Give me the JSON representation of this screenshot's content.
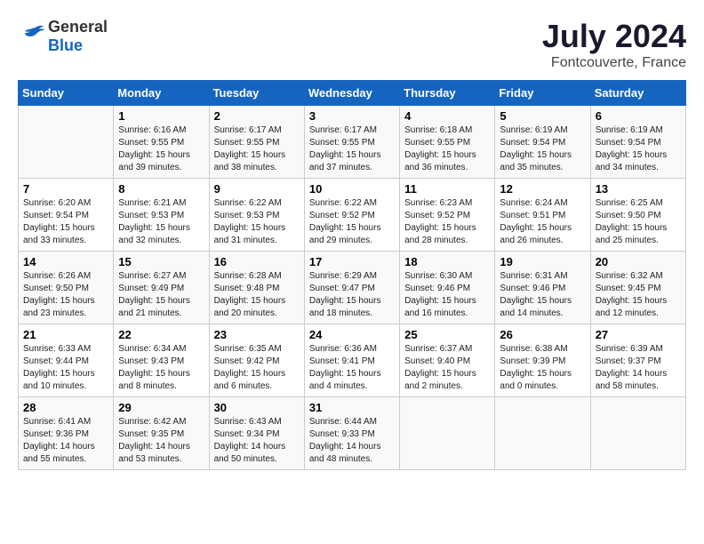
{
  "header": {
    "logo": {
      "general": "General",
      "blue": "Blue"
    },
    "title": "July 2024",
    "location": "Fontcouverte, France"
  },
  "weekdays": [
    "Sunday",
    "Monday",
    "Tuesday",
    "Wednesday",
    "Thursday",
    "Friday",
    "Saturday"
  ],
  "weeks": [
    [
      {
        "day": "",
        "content": ""
      },
      {
        "day": "1",
        "content": "Sunrise: 6:16 AM\nSunset: 9:55 PM\nDaylight: 15 hours\nand 39 minutes."
      },
      {
        "day": "2",
        "content": "Sunrise: 6:17 AM\nSunset: 9:55 PM\nDaylight: 15 hours\nand 38 minutes."
      },
      {
        "day": "3",
        "content": "Sunrise: 6:17 AM\nSunset: 9:55 PM\nDaylight: 15 hours\nand 37 minutes."
      },
      {
        "day": "4",
        "content": "Sunrise: 6:18 AM\nSunset: 9:55 PM\nDaylight: 15 hours\nand 36 minutes."
      },
      {
        "day": "5",
        "content": "Sunrise: 6:19 AM\nSunset: 9:54 PM\nDaylight: 15 hours\nand 35 minutes."
      },
      {
        "day": "6",
        "content": "Sunrise: 6:19 AM\nSunset: 9:54 PM\nDaylight: 15 hours\nand 34 minutes."
      }
    ],
    [
      {
        "day": "7",
        "content": "Sunrise: 6:20 AM\nSunset: 9:54 PM\nDaylight: 15 hours\nand 33 minutes."
      },
      {
        "day": "8",
        "content": "Sunrise: 6:21 AM\nSunset: 9:53 PM\nDaylight: 15 hours\nand 32 minutes."
      },
      {
        "day": "9",
        "content": "Sunrise: 6:22 AM\nSunset: 9:53 PM\nDaylight: 15 hours\nand 31 minutes."
      },
      {
        "day": "10",
        "content": "Sunrise: 6:22 AM\nSunset: 9:52 PM\nDaylight: 15 hours\nand 29 minutes."
      },
      {
        "day": "11",
        "content": "Sunrise: 6:23 AM\nSunset: 9:52 PM\nDaylight: 15 hours\nand 28 minutes."
      },
      {
        "day": "12",
        "content": "Sunrise: 6:24 AM\nSunset: 9:51 PM\nDaylight: 15 hours\nand 26 minutes."
      },
      {
        "day": "13",
        "content": "Sunrise: 6:25 AM\nSunset: 9:50 PM\nDaylight: 15 hours\nand 25 minutes."
      }
    ],
    [
      {
        "day": "14",
        "content": "Sunrise: 6:26 AM\nSunset: 9:50 PM\nDaylight: 15 hours\nand 23 minutes."
      },
      {
        "day": "15",
        "content": "Sunrise: 6:27 AM\nSunset: 9:49 PM\nDaylight: 15 hours\nand 21 minutes."
      },
      {
        "day": "16",
        "content": "Sunrise: 6:28 AM\nSunset: 9:48 PM\nDaylight: 15 hours\nand 20 minutes."
      },
      {
        "day": "17",
        "content": "Sunrise: 6:29 AM\nSunset: 9:47 PM\nDaylight: 15 hours\nand 18 minutes."
      },
      {
        "day": "18",
        "content": "Sunrise: 6:30 AM\nSunset: 9:46 PM\nDaylight: 15 hours\nand 16 minutes."
      },
      {
        "day": "19",
        "content": "Sunrise: 6:31 AM\nSunset: 9:46 PM\nDaylight: 15 hours\nand 14 minutes."
      },
      {
        "day": "20",
        "content": "Sunrise: 6:32 AM\nSunset: 9:45 PM\nDaylight: 15 hours\nand 12 minutes."
      }
    ],
    [
      {
        "day": "21",
        "content": "Sunrise: 6:33 AM\nSunset: 9:44 PM\nDaylight: 15 hours\nand 10 minutes."
      },
      {
        "day": "22",
        "content": "Sunrise: 6:34 AM\nSunset: 9:43 PM\nDaylight: 15 hours\nand 8 minutes."
      },
      {
        "day": "23",
        "content": "Sunrise: 6:35 AM\nSunset: 9:42 PM\nDaylight: 15 hours\nand 6 minutes."
      },
      {
        "day": "24",
        "content": "Sunrise: 6:36 AM\nSunset: 9:41 PM\nDaylight: 15 hours\nand 4 minutes."
      },
      {
        "day": "25",
        "content": "Sunrise: 6:37 AM\nSunset: 9:40 PM\nDaylight: 15 hours\nand 2 minutes."
      },
      {
        "day": "26",
        "content": "Sunrise: 6:38 AM\nSunset: 9:39 PM\nDaylight: 15 hours\nand 0 minutes."
      },
      {
        "day": "27",
        "content": "Sunrise: 6:39 AM\nSunset: 9:37 PM\nDaylight: 14 hours\nand 58 minutes."
      }
    ],
    [
      {
        "day": "28",
        "content": "Sunrise: 6:41 AM\nSunset: 9:36 PM\nDaylight: 14 hours\nand 55 minutes."
      },
      {
        "day": "29",
        "content": "Sunrise: 6:42 AM\nSunset: 9:35 PM\nDaylight: 14 hours\nand 53 minutes."
      },
      {
        "day": "30",
        "content": "Sunrise: 6:43 AM\nSunset: 9:34 PM\nDaylight: 14 hours\nand 50 minutes."
      },
      {
        "day": "31",
        "content": "Sunrise: 6:44 AM\nSunset: 9:33 PM\nDaylight: 14 hours\nand 48 minutes."
      },
      {
        "day": "",
        "content": ""
      },
      {
        "day": "",
        "content": ""
      },
      {
        "day": "",
        "content": ""
      }
    ]
  ]
}
